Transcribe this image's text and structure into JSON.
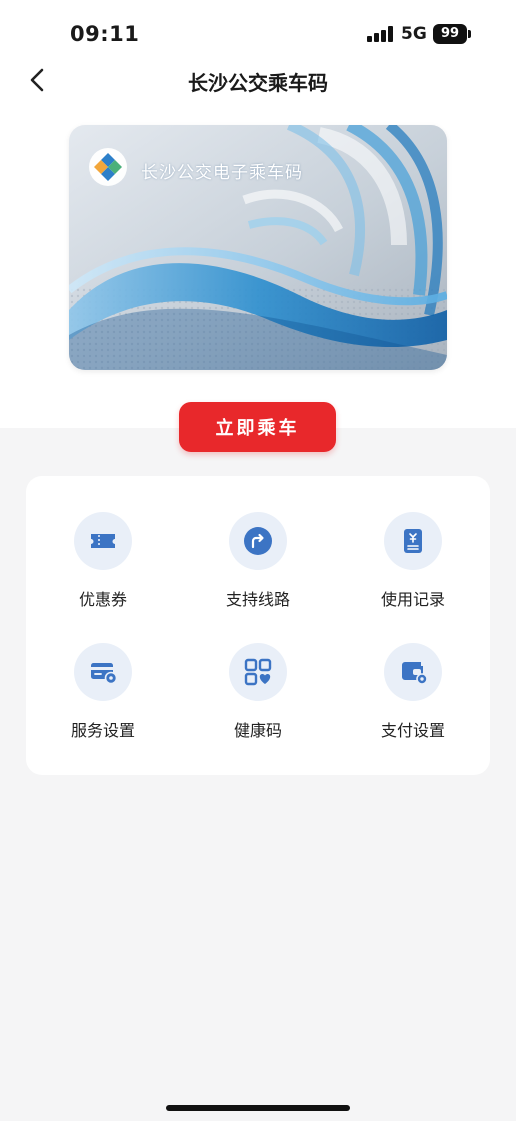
{
  "status_bar": {
    "time": "09:11",
    "network": "5G",
    "battery": "99"
  },
  "nav": {
    "title": "长沙公交乘车码"
  },
  "card": {
    "name": "长沙公交电子乘车码"
  },
  "ride_button": {
    "label": "立即乘车"
  },
  "services": [
    {
      "label": "优惠券",
      "icon": "coupon-icon"
    },
    {
      "label": "支持线路",
      "icon": "route-icon"
    },
    {
      "label": "使用记录",
      "icon": "record-icon"
    },
    {
      "label": "服务设置",
      "icon": "card-settings-icon"
    },
    {
      "label": "健康码",
      "icon": "health-code-icon"
    },
    {
      "label": "支付设置",
      "icon": "wallet-settings-icon"
    }
  ],
  "colors": {
    "accent": "#e8282b",
    "icon_blue": "#3c74c4",
    "icon_bg": "#e9eff8"
  }
}
